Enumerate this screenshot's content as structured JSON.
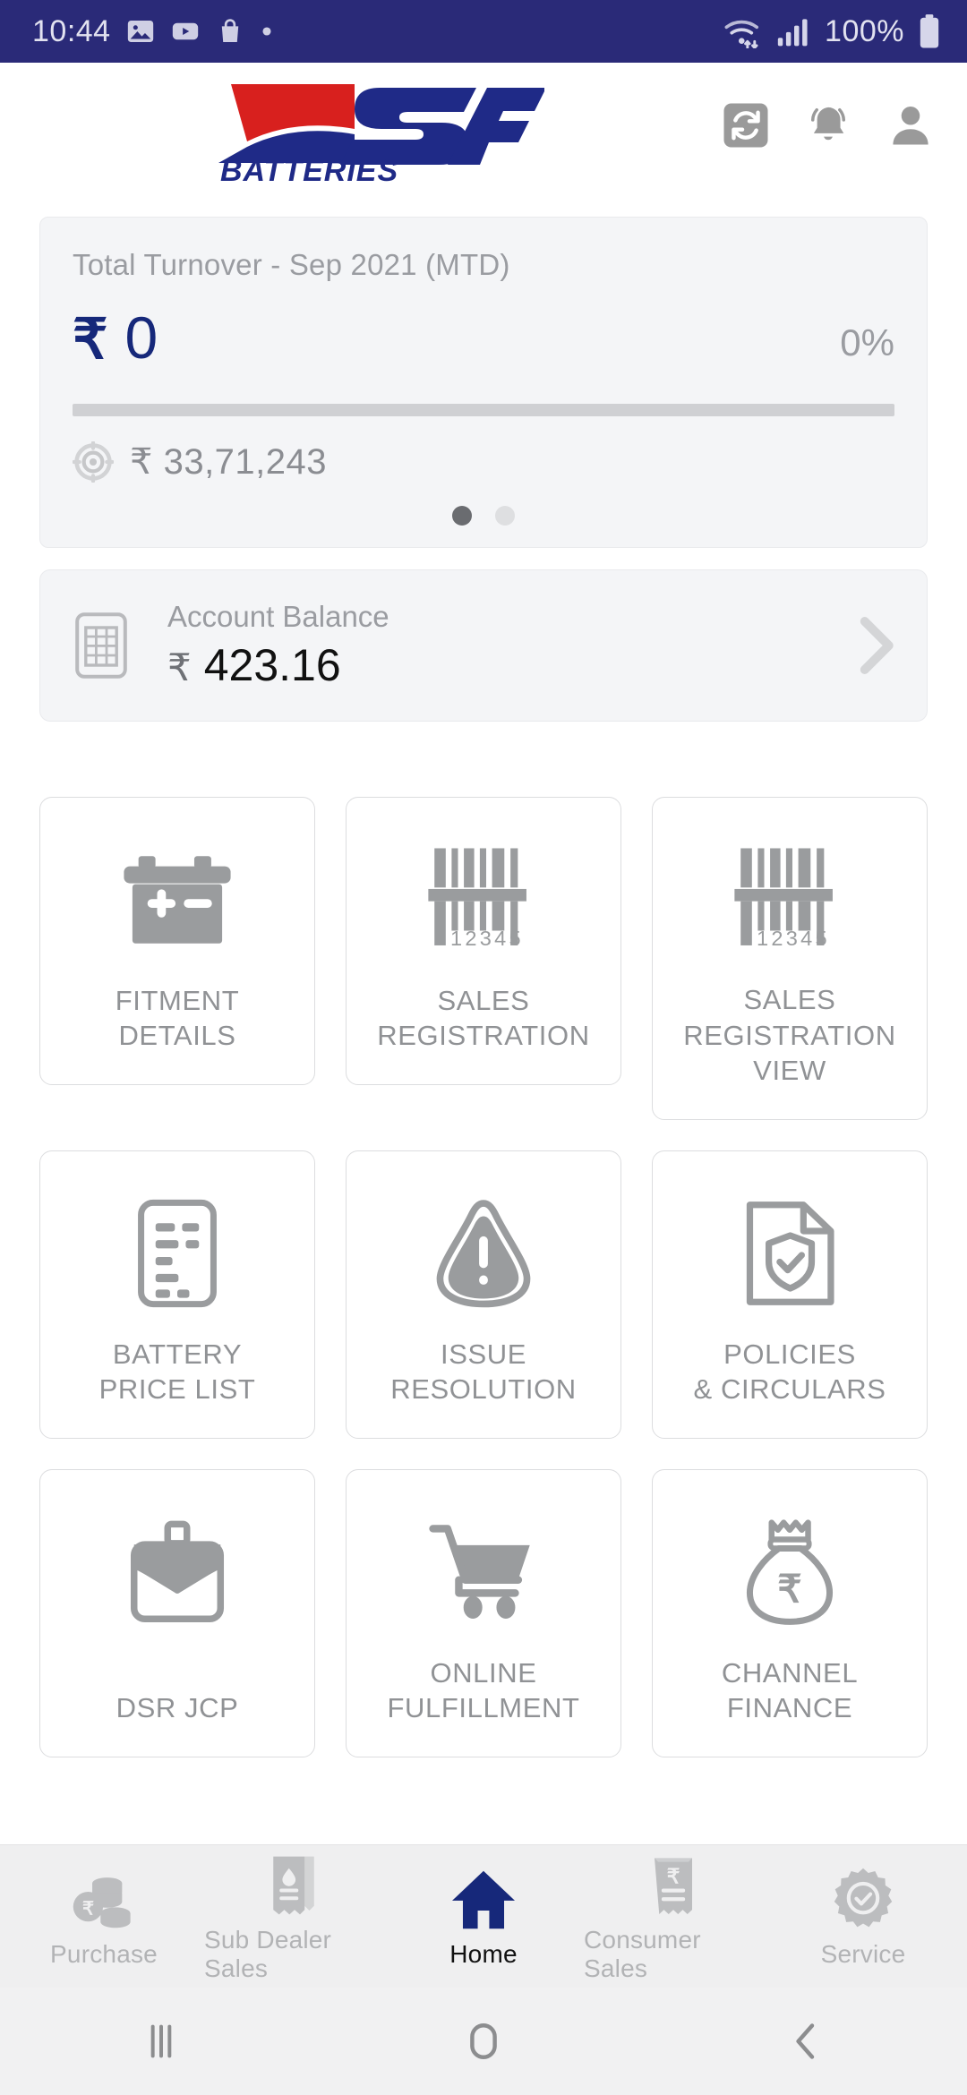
{
  "status_bar": {
    "time": "10:44",
    "left_icons": [
      "photos-icon",
      "youtube-icon",
      "shopping-bag-icon",
      "dot-indicator-icon"
    ],
    "wifi_icon": "wifi-icon",
    "signal_icon": "cellular-signal-icon",
    "battery_percent": "100%",
    "battery_icon": "battery-full-icon",
    "background_color": "#2a2a78"
  },
  "header": {
    "logo_primary": "SF",
    "logo_secondary": "BATTERIES",
    "logo_red": "#d8201e",
    "logo_blue": "#1f2a87",
    "icons": [
      {
        "name": "sync-icon",
        "label": "Sync"
      },
      {
        "name": "notification-bell-icon",
        "label": "Notifications"
      },
      {
        "name": "user-profile-icon",
        "label": "Profile"
      }
    ]
  },
  "turnover_card": {
    "title": "Total Turnover - Sep 2021 (MTD)",
    "currency_symbol": "₹",
    "amount": "0",
    "percent": "0%",
    "progress_percent": 0,
    "target_icon": "target-icon",
    "target_currency": "₹",
    "target_amount": "33,71,243",
    "dots_total": 2,
    "dots_active_index": 0,
    "accent_color": "#16287a"
  },
  "balance_card": {
    "icon": "ledger-icon",
    "label": "Account Balance",
    "currency_symbol": "₹",
    "value": "423.16",
    "chevron_icon": "chevron-right-icon"
  },
  "tiles": [
    [
      {
        "label": "FITMENT\nDETAILS",
        "icon": "battery-icon",
        "tall": false
      },
      {
        "label": "SALES\nREGISTRATION",
        "icon": "barcode-icon",
        "tall": false
      },
      {
        "label": "SALES\nREGISTRATION\nVIEW",
        "icon": "barcode-icon",
        "tall": true
      }
    ],
    [
      {
        "label": "BATTERY\nPRICE LIST",
        "icon": "price-list-icon",
        "tall": false
      },
      {
        "label": "ISSUE\nRESOLUTION",
        "icon": "warning-triangle-icon",
        "tall": false
      },
      {
        "label": "POLICIES\n& CIRCULARS",
        "icon": "document-shield-icon",
        "tall": false
      }
    ],
    [
      {
        "label": "DSR JCP",
        "icon": "briefcase-icon",
        "tall": false
      },
      {
        "label": "ONLINE\nFULFILLMENT",
        "icon": "shopping-cart-icon",
        "tall": false
      },
      {
        "label": "CHANNEL\nFINANCE",
        "icon": "money-bag-icon",
        "tall": false
      }
    ]
  ],
  "bottom_nav": {
    "active_index": 2,
    "active_color": "#16287a",
    "items": [
      {
        "label": "Purchase",
        "icon": "coins-icon"
      },
      {
        "label": "Sub Dealer Sales",
        "icon": "receipt-drop-icon"
      },
      {
        "label": "Home",
        "icon": "home-icon"
      },
      {
        "label": "Consumer Sales",
        "icon": "receipt-rupee-icon"
      },
      {
        "label": "Service",
        "icon": "service-badge-icon"
      }
    ]
  },
  "system_nav": {
    "recents_icon": "recents-icon",
    "home_icon": "home-circle-icon",
    "back_icon": "back-chevron-icon"
  }
}
